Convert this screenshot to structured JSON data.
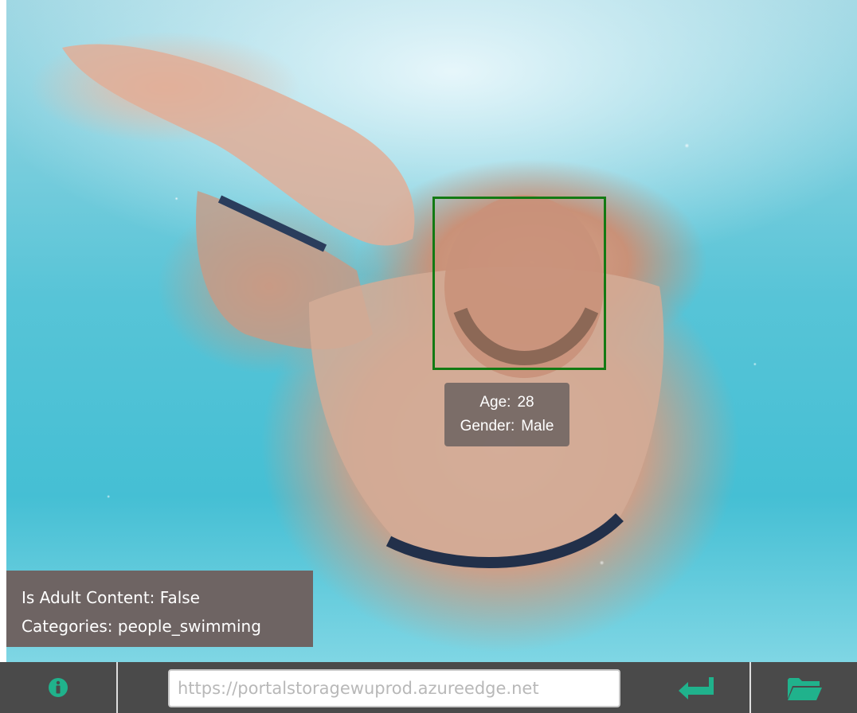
{
  "face": {
    "age_label": "Age:",
    "age_value": "28",
    "gender_label": "Gender:",
    "gender_value": "Male",
    "box_color": "#137a13"
  },
  "analysis": {
    "adult_content": "Is Adult Content: False",
    "categories": "Categories: people_swimming"
  },
  "toolbar": {
    "url_placeholder": "https://portalstoragewuprod.azureedge.net",
    "accent_color": "#20b28c",
    "info_icon": "info-icon",
    "submit_icon": "enter-arrow-icon",
    "open_icon": "folder-open-icon"
  }
}
